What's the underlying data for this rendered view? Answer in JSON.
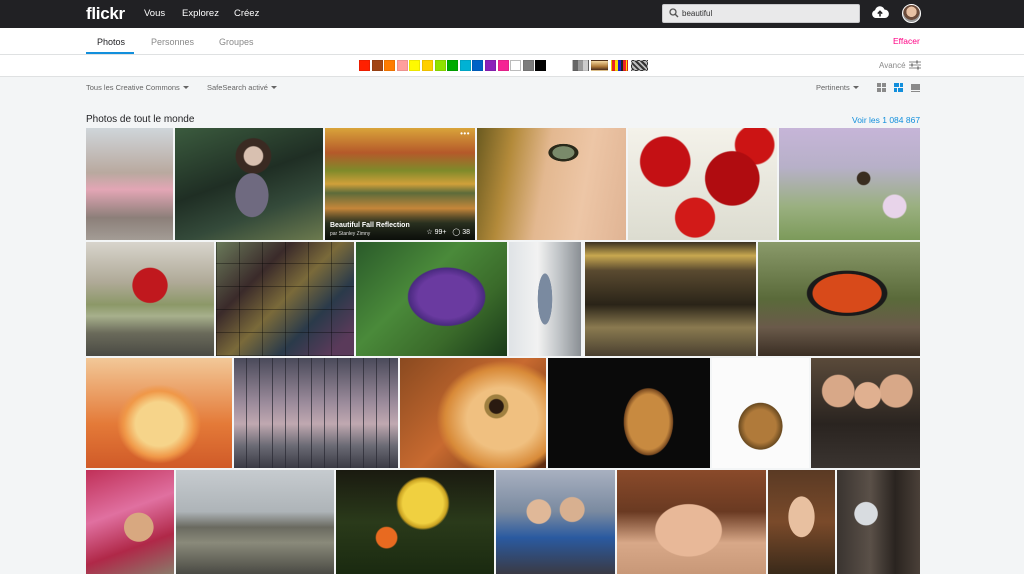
{
  "header": {
    "logo": "flickr",
    "nav": [
      "Vous",
      "Explorez",
      "Créez"
    ],
    "search_value": "beautiful"
  },
  "tabs": {
    "items": [
      "Photos",
      "Personnes",
      "Groupes"
    ],
    "active": "Photos",
    "clear_label": "Effacer"
  },
  "colors": {
    "swatches": [
      "#ff2000",
      "#a24615",
      "#ff7c00",
      "#ff9f9c",
      "#fffa00",
      "#ffcf00",
      "#90e200",
      "#00ab00",
      "#00b2d4",
      "#0062c6",
      "#8c20ba",
      "#f52394",
      "#ffffff",
      "#7c7c7c",
      "#000000"
    ],
    "advanced_label": "Avancé"
  },
  "filters": {
    "license": "Tous les Creative Commons",
    "safesearch": "SafeSearch activé",
    "sort": "Pertinents"
  },
  "results": {
    "section_title": "Photos de tout le monde",
    "view_all": "Voir les 1 084 867"
  },
  "featured_photo": {
    "title": "Beautiful Fall Reflection",
    "author": "par Stanley Zimny",
    "faves": "99+",
    "comments": "38"
  },
  "accent_colors": {
    "flickr_blue": "#128fdc",
    "flickr_pink": "#ff0084",
    "topbar": "#212124"
  }
}
